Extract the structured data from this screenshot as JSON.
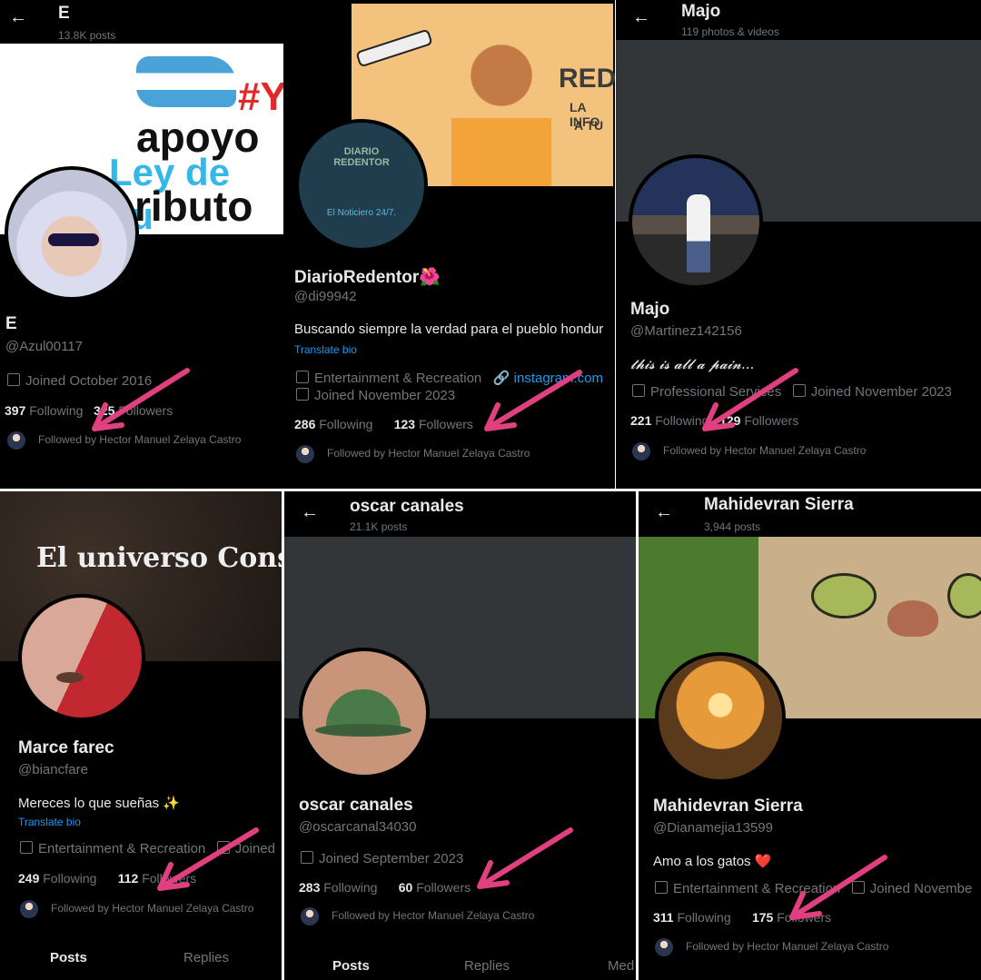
{
  "panels": [
    {
      "topbar_title": "E",
      "topbar_sub": "13.8K posts",
      "banner_text": {
        "hashtag": "#Y",
        "line1": "apoyo",
        "line2": "Ley de Ju",
        "line3": "ributo"
      },
      "name": "E",
      "handle": "@Azul00117",
      "meta": [
        "Joined October 2016"
      ],
      "following": "397",
      "following_label": "Following",
      "followers": "325",
      "followers_label": "Followers",
      "followed_by": "Followed by Hector Manuel Zelaya Castro"
    },
    {
      "banner_text": {
        "brand": "RED",
        "tag1": "LA INFO",
        "tag2": "A TU"
      },
      "avatar_text": {
        "logo": "DIARIO REDENTOR",
        "caption": "El Noticiero 24/7."
      },
      "name": "DiarioRedentor🌺",
      "handle": "@di99942",
      "bio": "Buscando siempre la verdad para el pueblo hondur",
      "translate": "Translate bio",
      "meta": [
        "Entertainment & Recreation",
        "instagram.com",
        "Joined November 2023"
      ],
      "following": "286",
      "following_label": "Following",
      "followers": "123",
      "followers_label": "Followers",
      "followed_by": "Followed by Hector Manuel Zelaya Castro"
    },
    {
      "topbar_title": "Majo",
      "topbar_sub": "119 photos & videos",
      "name": "Majo",
      "handle": "@Martinez142156",
      "bio": "𝓽𝓱𝓲𝓼 𝓲𝓼 𝓪𝓵𝓵 𝓪 𝓹𝓪𝓲𝓷...",
      "meta": [
        "Professional Services",
        "Joined November 2023"
      ],
      "following": "221",
      "following_label": "Following",
      "followers": "129",
      "followers_label": "Followers",
      "followed_by": "Followed by Hector Manuel Zelaya Castro"
    },
    {
      "banner_text": {
        "line": "El universo Cons"
      },
      "name": "Marce farec",
      "handle": "@biancfare",
      "bio": "Mereces lo que sueñas ✨",
      "translate": "Translate bio",
      "meta": [
        "Entertainment & Recreation",
        "Joined"
      ],
      "following": "249",
      "following_label": "Following",
      "followers": "112",
      "followers_label": "Followers",
      "followed_by": "Followed by Hector Manuel Zelaya Castro",
      "tabs": [
        "Posts",
        "Replies"
      ]
    },
    {
      "topbar_title": "oscar canales",
      "topbar_sub": "21.1K posts",
      "name": "oscar canales",
      "handle": "@oscarcanal34030",
      "meta": [
        "Joined September 2023"
      ],
      "following": "283",
      "following_label": "Following",
      "followers": "60",
      "followers_label": "Followers",
      "followed_by": "Followed by Hector Manuel Zelaya Castro",
      "tabs": [
        "Posts",
        "Replies",
        "Med"
      ]
    },
    {
      "topbar_title": "Mahidevran Sierra",
      "topbar_sub": "3,944 posts",
      "name": "Mahidevran Sierra",
      "handle": "@Dianamejia13599",
      "bio": "Amo a los gatos ❤️",
      "meta": [
        "Entertainment & Recreation",
        "Joined Novembe"
      ],
      "following": "311",
      "following_label": "Following",
      "followers": "175",
      "followers_label": "Followers",
      "followed_by": "Followed by Hector Manuel Zelaya Castro"
    }
  ],
  "colors": {
    "arrow": "#e0407f",
    "link": "#1d9bf0",
    "muted": "#71767b",
    "text": "#e7e9ea"
  }
}
